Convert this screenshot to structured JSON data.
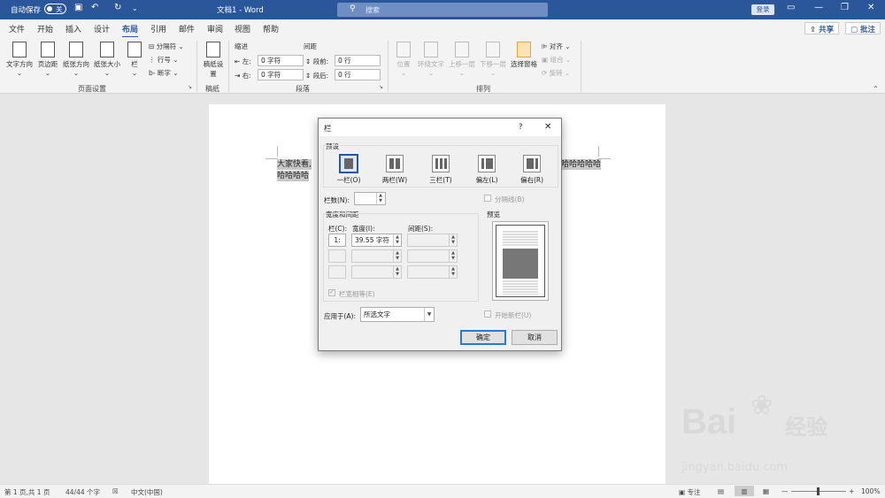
{
  "titlebar": {
    "autosave_label": "自动保存",
    "autosave_state": "关",
    "doc_title": "文档1 - Word",
    "search_placeholder": "搜索",
    "login_label": "登录"
  },
  "tabs": [
    "文件",
    "开始",
    "插入",
    "设计",
    "布局",
    "引用",
    "邮件",
    "审阅",
    "视图",
    "帮助"
  ],
  "active_tab": "布局",
  "header_buttons": {
    "share": "共享",
    "comments": "批注"
  },
  "ribbon": {
    "page_setup": {
      "label": "页面设置",
      "buttons": [
        "文字方向",
        "页边距",
        "纸张方向",
        "纸张大小",
        "栏"
      ],
      "small": [
        "分隔符",
        "行号",
        "断字"
      ]
    },
    "draft": {
      "label": "稿纸",
      "button": "稿纸设置"
    },
    "paragraph": {
      "label": "段落",
      "indent_label": "缩进",
      "spacing_label": "间距",
      "left_label": "左:",
      "left_value": "0 字符",
      "right_label": "右:",
      "right_value": "0 字符",
      "before_label": "段前:",
      "before_value": "0 行",
      "after_label": "段后:",
      "after_value": "0 行"
    },
    "arrange": {
      "label": "排列",
      "buttons": [
        "位置",
        "环绕文字",
        "上移一层",
        "下移一层",
        "选择窗格"
      ],
      "small": [
        "对齐",
        "组合",
        "旋转"
      ]
    }
  },
  "document": {
    "line1_left": "大家快看,",
    "line1_right": "哈哈哈哈哈",
    "line2": "哈哈哈哈"
  },
  "dialog": {
    "title": "栏",
    "help": "?",
    "close": "✕",
    "presets_label": "预设",
    "presets": [
      "一栏(O)",
      "两栏(W)",
      "三栏(T)",
      "偏左(L)",
      "偏右(R)"
    ],
    "selected_preset": "一栏(O)",
    "columns_count_label": "栏数(N):",
    "columns_count_value": "",
    "separator_label": "分隔线(B)",
    "width_spacing_label": "宽度和间距",
    "col_header": "栏(C):",
    "width_header": "宽度(I):",
    "spacing_header": "间距(S):",
    "rows": [
      {
        "col": "1:",
        "width": "39.55 字符",
        "spacing": ""
      },
      {
        "col": "",
        "width": "",
        "spacing": ""
      },
      {
        "col": "",
        "width": "",
        "spacing": ""
      }
    ],
    "equal_width_label": "栏宽相等(E)",
    "preview_label": "预览",
    "apply_label": "应用于(A):",
    "apply_value": "所选文字",
    "new_column_label": "开始新栏(U)",
    "ok": "确定",
    "cancel": "取消"
  },
  "status": {
    "page": "第 1 页,共 1 页",
    "words": "44/44 个字",
    "lang": "中文(中国)",
    "focus": "专注",
    "zoom": "100%"
  },
  "watermark": {
    "brand": "Bai",
    "brand2": "经验",
    "url": "jingyan.baidu.com"
  },
  "colors": {
    "accent": "#2b579a",
    "watermark": "#d9d9d9"
  }
}
